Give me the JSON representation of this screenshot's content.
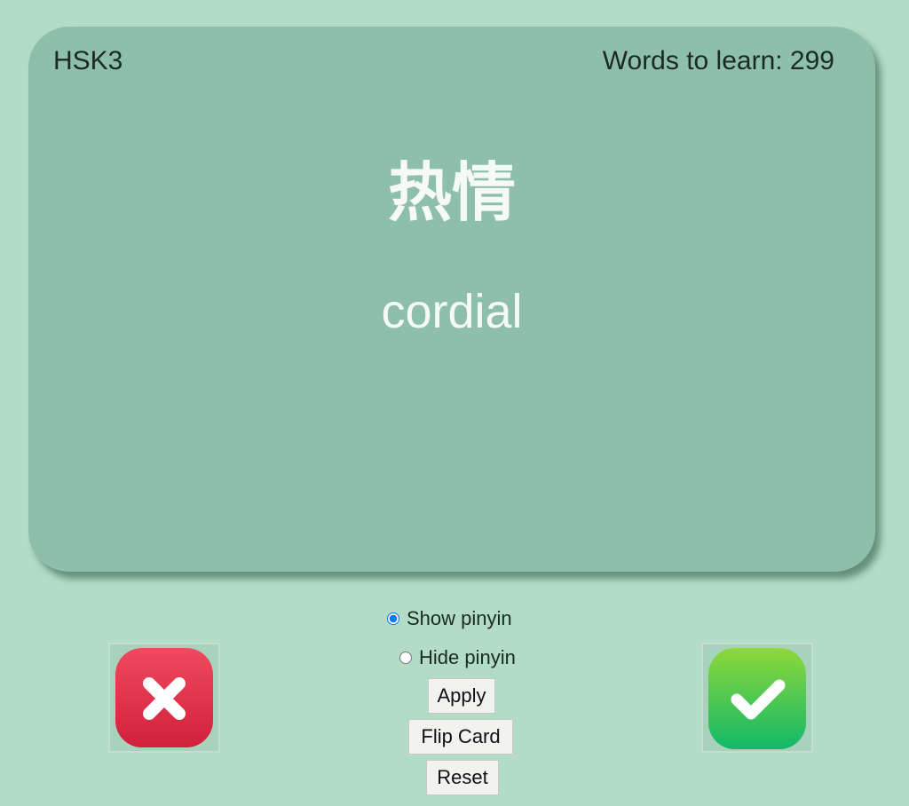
{
  "card": {
    "level": "HSK3",
    "words_to_learn": "Words to learn: 299",
    "hanzi": "热情",
    "meaning": "cordial"
  },
  "controls": {
    "show_pinyin_label": "Show pinyin",
    "hide_pinyin_label": "Hide pinyin",
    "selected": "show",
    "apply_label": "Apply",
    "flip_label": "Flip Card",
    "reset_label": "Reset"
  },
  "icons": {
    "wrong": "close-icon",
    "right": "check-icon"
  },
  "colors": {
    "background": "#b2dcc6",
    "card": "#8ebfad",
    "wrong": "#e3324b",
    "right": "#2ec44f"
  }
}
